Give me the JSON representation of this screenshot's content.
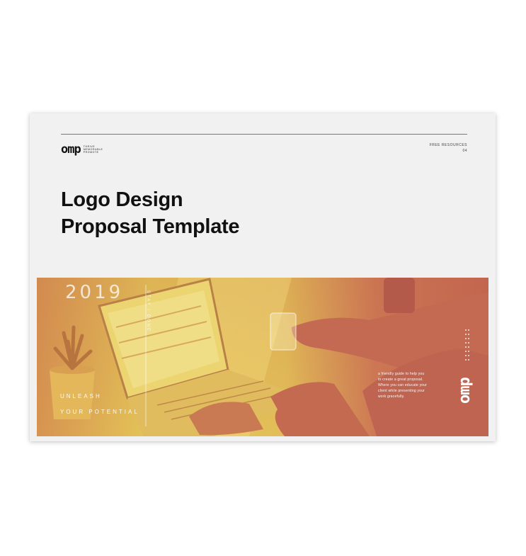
{
  "header": {
    "logo_text": "omp",
    "logo_taglines": [
      "THRIVE",
      "MEMORABLE",
      "PROMOTE"
    ],
    "meta_lines": [
      "FREE RESOURCES",
      "04"
    ]
  },
  "title": {
    "line1": "Logo Design",
    "line2": "Proposal Template"
  },
  "banner": {
    "year": "2019",
    "vertical_text": "STAY / DONE",
    "unleash": "UNLEASH",
    "potential": "YOUR POTENTIAL",
    "description_lines": [
      "a friendly guide to help you",
      "to create a great proposal.",
      "Where you can educate your",
      "client while presenting your",
      "work gracefully."
    ],
    "logo_text": "omp"
  },
  "colors": {
    "card_bg": "#f1f1f1",
    "banner_yellow": "#e8d25a",
    "banner_red": "#c46a52",
    "text_dark": "#111111"
  }
}
